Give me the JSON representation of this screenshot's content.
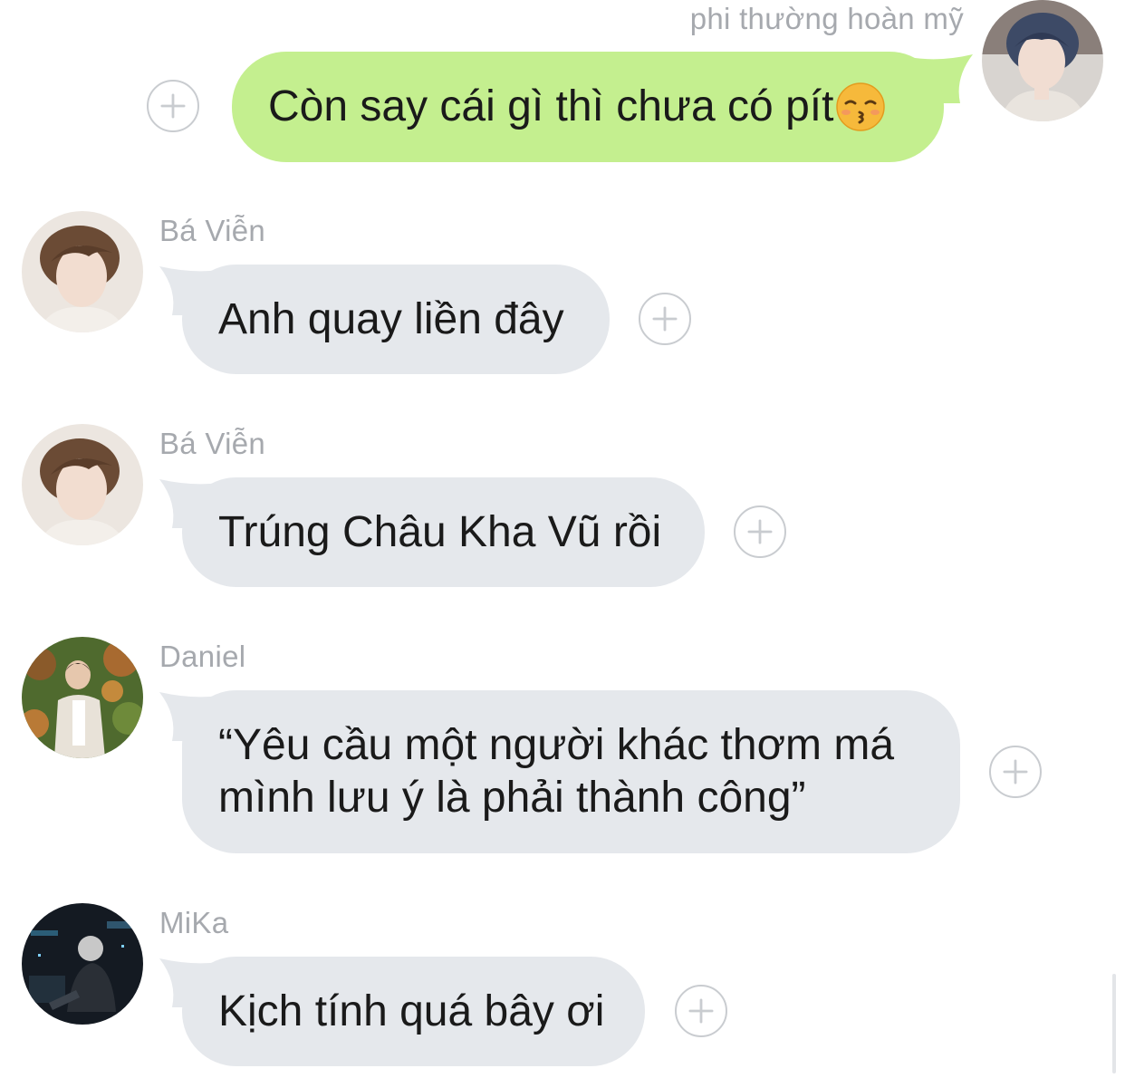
{
  "messages": [
    {
      "sender": "phi thường hoàn mỹ",
      "text": "Còn say cái gì thì chưa có pít",
      "emoji": "kissing-face-closed-eyes",
      "outgoing": true
    },
    {
      "sender": "Bá Viễn",
      "text": "Anh quay liền đây",
      "outgoing": false
    },
    {
      "sender": "Bá Viễn",
      "text": "Trúng Châu Kha Vũ rồi",
      "outgoing": false
    },
    {
      "sender": "Daniel",
      "text": "“Yêu cầu một người khác thơm má\nmình lưu ý là phải thành công”",
      "outgoing": false
    },
    {
      "sender": "MiKa",
      "text": "Kịch tính quá bây ơi",
      "outgoing": false
    }
  ],
  "colors": {
    "outgoing_bubble": "#c4ef8f",
    "incoming_bubble": "#e5e8ec",
    "name_text": "#a6a9ae"
  },
  "icons": {
    "react": "plus-circle-icon",
    "emoji": "kissing-face-closed-eyes"
  }
}
